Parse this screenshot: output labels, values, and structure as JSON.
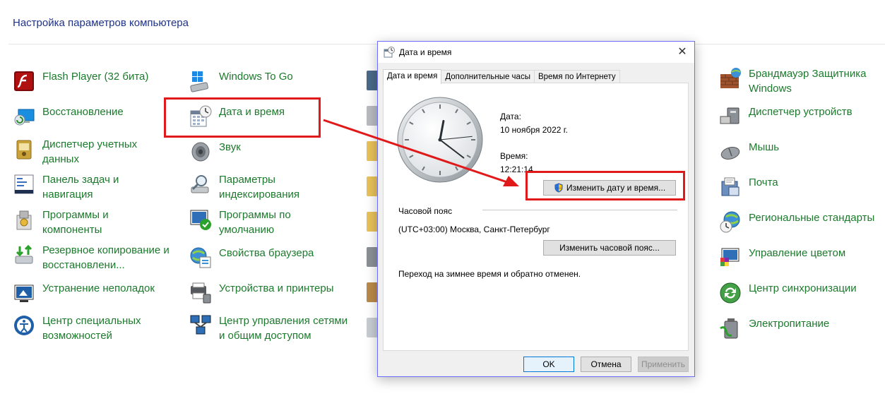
{
  "page": {
    "title": "Настройка параметров компьютера"
  },
  "control_panel": {
    "column1": [
      {
        "label": "Flash Player (32 бита)",
        "icon": "flash-player-icon"
      },
      {
        "label": "Восстановление",
        "icon": "recovery-icon"
      },
      {
        "label": "Диспетчер учетных\nданных",
        "icon": "credential-manager-icon"
      },
      {
        "label": "Панель задач и\nнавигация",
        "icon": "taskbar-icon"
      },
      {
        "label": "Программы и\nкомпоненты",
        "icon": "programs-icon"
      },
      {
        "label": "Резервное копирование и\nвосстановлени...",
        "icon": "backup-icon"
      },
      {
        "label": "Устранение неполадок",
        "icon": "troubleshooting-icon"
      },
      {
        "label": "Центр специальных\nвозможностей",
        "icon": "ease-of-access-icon"
      }
    ],
    "column2": [
      {
        "label": "Windows To Go",
        "icon": "windows-to-go-icon"
      },
      {
        "label": "Дата и время",
        "icon": "date-time-icon"
      },
      {
        "label": "Звук",
        "icon": "sound-icon"
      },
      {
        "label": "Параметры\nиндексирования",
        "icon": "indexing-icon"
      },
      {
        "label": "Программы по\nумолчанию",
        "icon": "default-programs-icon"
      },
      {
        "label": "Свойства браузера",
        "icon": "internet-options-icon"
      },
      {
        "label": "Устройства и принтеры",
        "icon": "devices-printers-icon"
      },
      {
        "label": "Центр управления сетями\nи общим доступом",
        "icon": "network-center-icon"
      }
    ],
    "column4": [
      {
        "label": "Брандмауэр Защитника\nWindows",
        "icon": "firewall-icon"
      },
      {
        "label": "Диспетчер устройств",
        "icon": "device-manager-icon"
      },
      {
        "label": "Мышь",
        "icon": "mouse-icon"
      },
      {
        "label": "Почта",
        "icon": "mail-icon"
      },
      {
        "label": "Региональные стандарты",
        "icon": "region-icon"
      },
      {
        "label": "Управление цветом",
        "icon": "color-management-icon"
      },
      {
        "label": "Центр синхронизации",
        "icon": "sync-center-icon"
      },
      {
        "label": "Электропитание",
        "icon": "power-options-icon"
      }
    ]
  },
  "dialog": {
    "title": "Дата и время",
    "tabs": [
      "Дата и время",
      "Дополнительные часы",
      "Время по Интернету"
    ],
    "active_tab": 0,
    "date_label": "Дата:",
    "date_value": "10 ноября 2022 г.",
    "time_label": "Время:",
    "time_value": "12:21:14",
    "change_datetime_button": "Изменить дату и время...",
    "timezone_label": "Часовой пояс",
    "timezone_value": "(UTC+03:00) Москва, Санкт-Петербург",
    "change_timezone_button": "Изменить часовой пояс...",
    "dst_note": "Переход на зимнее время и обратно отменен.",
    "ok_button": "OK",
    "cancel_button": "Отмена",
    "apply_button": "Применить"
  },
  "colors": {
    "link_green": "#1c7a2c",
    "title_blue": "#1e3287",
    "highlight_red": "#e01a1a",
    "dialog_border": "#6c6cff",
    "default_button_border": "#0078d7"
  }
}
